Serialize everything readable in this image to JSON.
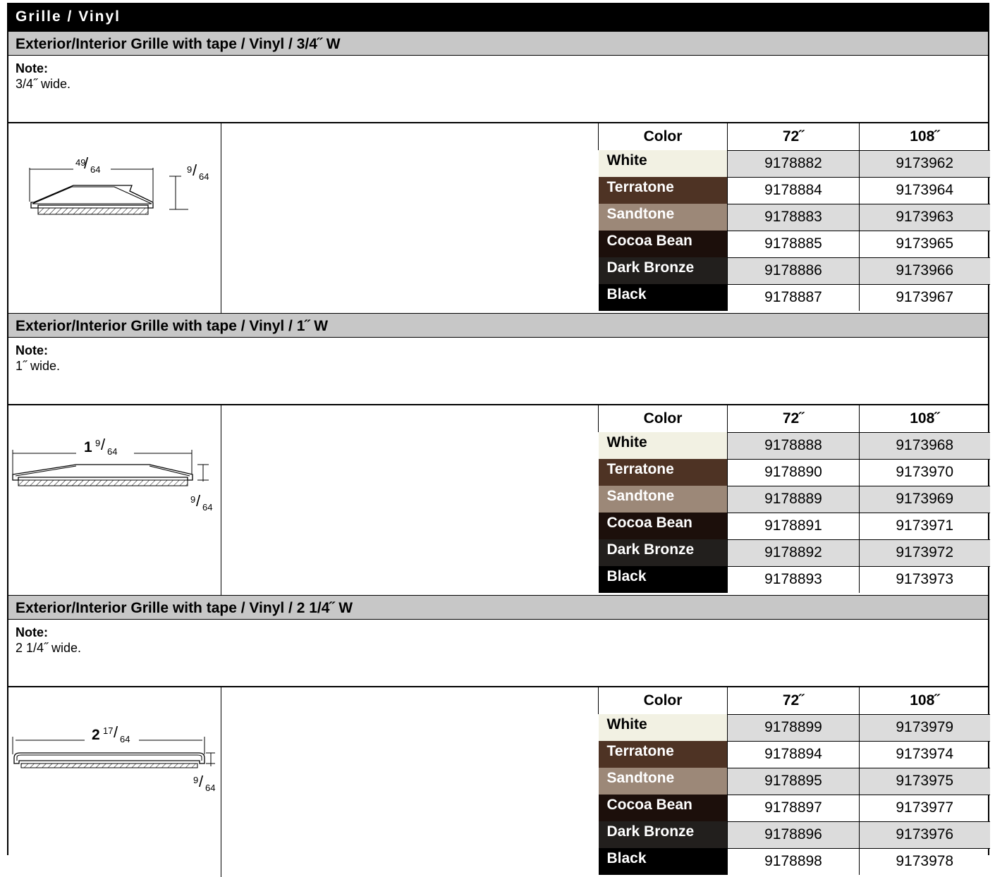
{
  "title": "Grille / Vinyl",
  "note_label": "Note:",
  "table_headers": {
    "color": "Color",
    "len1": "72˝",
    "len2": "108˝"
  },
  "swatch_colors": {
    "White": "#f2f1e3",
    "Terratone": "#4e3324",
    "Sandtone": "#9c8878",
    "Cocoa Bean": "#1c0f0b",
    "Dark Bronze": "#221f1d",
    "Black": "#000000"
  },
  "sections": [
    {
      "heading": "Exterior/Interior Grille with tape / Vinyl / 3/4˝ W",
      "note": "3/4˝ wide.",
      "drawing": {
        "width_whole": "",
        "width_num": "49",
        "width_den": "64",
        "height_num": "9",
        "height_den": "64"
      },
      "rows": [
        {
          "color": "White",
          "p72": "9178882",
          "p108": "9173962"
        },
        {
          "color": "Terratone",
          "p72": "9178884",
          "p108": "9173964"
        },
        {
          "color": "Sandtone",
          "p72": "9178883",
          "p108": "9173963"
        },
        {
          "color": "Cocoa Bean",
          "p72": "9178885",
          "p108": "9173965"
        },
        {
          "color": "Dark Bronze",
          "p72": "9178886",
          "p108": "9173966"
        },
        {
          "color": "Black",
          "p72": "9178887",
          "p108": "9173967"
        }
      ]
    },
    {
      "heading": "Exterior/Interior Grille with tape / Vinyl / 1˝ W",
      "note": "1˝ wide.",
      "drawing": {
        "width_whole": "1",
        "width_num": "9",
        "width_den": "64",
        "height_num": "9",
        "height_den": "64"
      },
      "rows": [
        {
          "color": "White",
          "p72": "9178888",
          "p108": "9173968"
        },
        {
          "color": "Terratone",
          "p72": "9178890",
          "p108": "9173970"
        },
        {
          "color": "Sandtone",
          "p72": "9178889",
          "p108": "9173969"
        },
        {
          "color": "Cocoa Bean",
          "p72": "9178891",
          "p108": "9173971"
        },
        {
          "color": "Dark Bronze",
          "p72": "9178892",
          "p108": "9173972"
        },
        {
          "color": "Black",
          "p72": "9178893",
          "p108": "9173973"
        }
      ]
    },
    {
      "heading": "Exterior/Interior Grille with tape / Vinyl / 2 1/4˝ W",
      "note": "2 1/4˝ wide.",
      "drawing": {
        "width_whole": "2",
        "width_num": "17",
        "width_den": "64",
        "height_num": "9",
        "height_den": "64"
      },
      "rows": [
        {
          "color": "White",
          "p72": "9178899",
          "p108": "9173979"
        },
        {
          "color": "Terratone",
          "p72": "9178894",
          "p108": "9173974"
        },
        {
          "color": "Sandtone",
          "p72": "9178895",
          "p108": "9173975"
        },
        {
          "color": "Cocoa Bean",
          "p72": "9178897",
          "p108": "9173977"
        },
        {
          "color": "Dark Bronze",
          "p72": "9178896",
          "p108": "9173976"
        },
        {
          "color": "Black",
          "p72": "9178898",
          "p108": "9173978"
        }
      ]
    }
  ]
}
